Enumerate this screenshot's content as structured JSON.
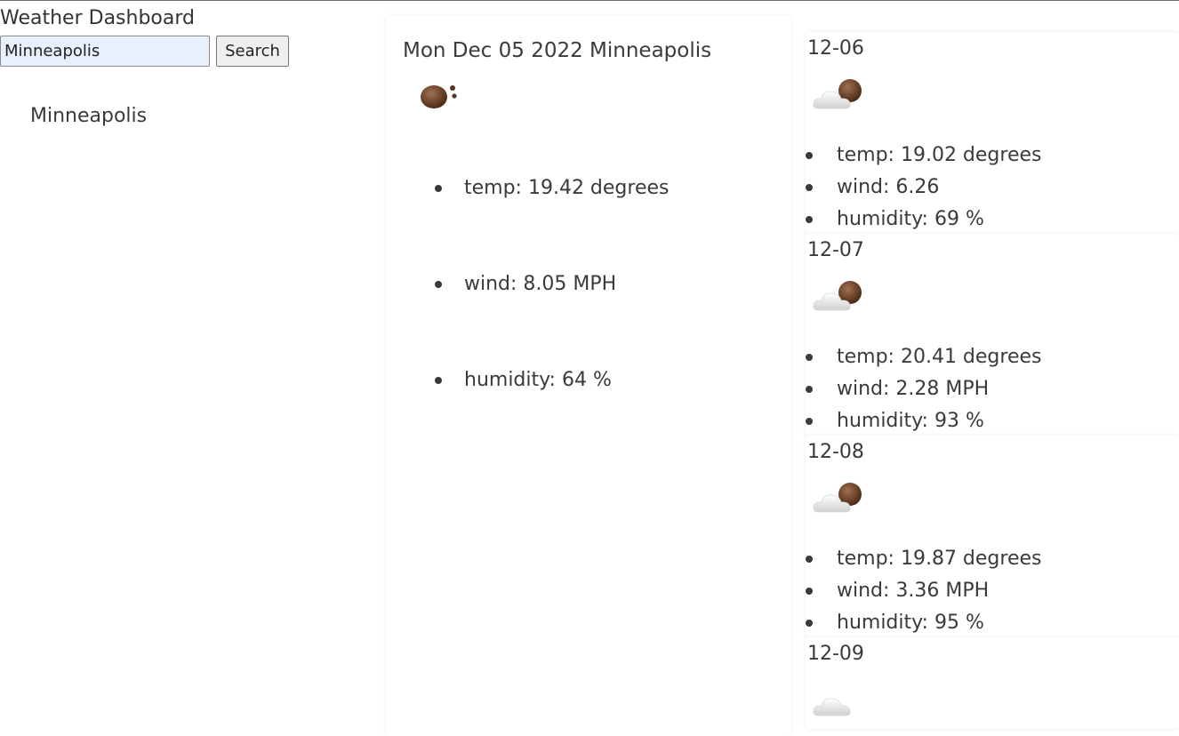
{
  "app": {
    "title": "Weather Dashboard"
  },
  "search": {
    "value": "Minneapolis",
    "button_label": "Search"
  },
  "history": [
    "Minneapolis"
  ],
  "current": {
    "title": "Mon Dec 05 2022 Minneapolis",
    "icon": "rain-drops-brown-icon",
    "items": [
      "temp: 19.42 degrees",
      "wind: 8.05 MPH",
      "humidity: 64 %"
    ]
  },
  "forecast": [
    {
      "date": "12-06",
      "icon": "cloud-partly-brown-icon",
      "items": [
        "temp: 19.02 degrees",
        "wind: 6.26",
        "humidity: 69 %"
      ]
    },
    {
      "date": "12-07",
      "icon": "cloud-partly-brown-icon",
      "items": [
        "temp: 20.41 degrees",
        "wind: 2.28 MPH",
        "humidity: 93 %"
      ]
    },
    {
      "date": "12-08",
      "icon": "cloud-partly-brown-icon",
      "items": [
        "temp: 19.87 degrees",
        "wind: 3.36 MPH",
        "humidity: 95 %"
      ]
    },
    {
      "date": "12-09",
      "icon": "cloud-icon",
      "items": []
    }
  ]
}
